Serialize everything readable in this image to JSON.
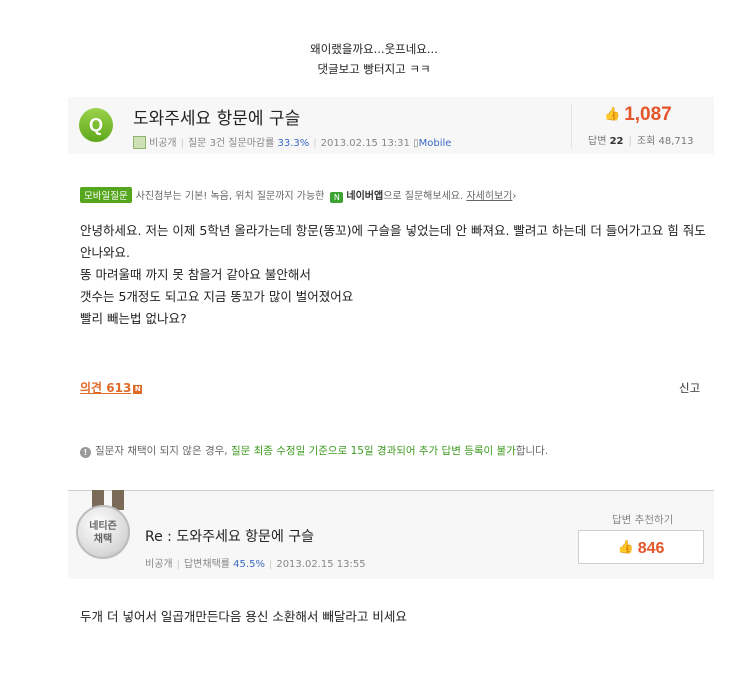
{
  "captions": [
    "왜이랬을까요...웃프네요...",
    "댓글보고 빵터지고 ㅋㅋ"
  ],
  "question": {
    "icon_letter": "Q",
    "title": "도와주세요 항문에 구슬",
    "author": "비공개",
    "stats_text": "질문 3건 질문마감률",
    "close_rate": "33.3%",
    "date": "2013.02.15 13:31",
    "platform": "Mobile",
    "likes": "1,087",
    "answers_label": "답변",
    "answers_count": "22",
    "views_label": "조회",
    "views_count": "48,713"
  },
  "mobile_bar": {
    "tag": "모바일질문",
    "text": "사진첨부는 기본! 녹음, 위치 질문까지 가능한",
    "app_name": "네이버앱",
    "app_suffix": "으로 질문해보세요.",
    "link": "자세히보기"
  },
  "question_body": [
    "안녕하세요. 저는 이제 5학년 올라가는데 항문(똥꼬)에 구슬을 넣었는데 안 빠져요. 빨려고 하는데 더 들어가고요 힘 줘도 안나와요.",
    "똥 마려울때 까지 못 참을거 같아요 불안해서",
    "갯수는 5개정도 되고요 지금 똥꼬가 많이 벌어졌어요",
    "빨리 빼는법 없나요?"
  ],
  "opinion_label": "의견 613",
  "opinion_badge": "N",
  "report_label": "신고",
  "notice": {
    "part1": "질문자 채택이 되지 않은 경우, ",
    "part2": "질문 최종 수정일 기준으로 15일 경과되어 추가 답변 등록이 불가",
    "part3": "합니다."
  },
  "answer": {
    "medal_line1": "네티즌",
    "medal_line2": "채택",
    "title": "Re : 도와주세요 항문에 구슬",
    "author": "비공개",
    "stats_text": "답변채택률",
    "adopt_rate": "45.5%",
    "date": "2013.02.15 13:55",
    "recommend_label": "답변 추천하기",
    "recommend_count": "846",
    "body": "두개 더 넣어서 일곱개만든다음 용신 소환해서 빼달라고 비세요"
  },
  "colors": {
    "accent": "#e4562a",
    "green": "#3d9a1e",
    "blue": "#3b6ac4"
  }
}
